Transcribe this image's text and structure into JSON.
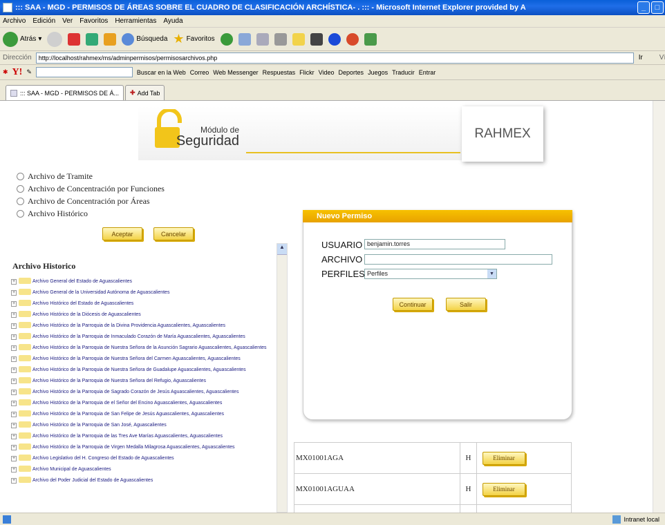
{
  "window": {
    "title": "::: SAA - MGD - PERMISOS DE ÁREAS SOBRE EL CUADRO DE CLASIFICACIÓN ARCHÍSTICA- . ::: - Microsoft Internet Explorer provided by A"
  },
  "menu": [
    "Archivo",
    "Edición",
    "Ver",
    "Favoritos",
    "Herramientas",
    "Ayuda"
  ],
  "toolbar": {
    "back": "Atrás",
    "search": "Búsqueda",
    "favorites": "Favoritos"
  },
  "address": {
    "label": "Dirección",
    "url": "http://localhost/rahmex/ms/adminpermisos/permisosarchivos.php",
    "go": "Ir",
    "links": "Vínculos"
  },
  "yahoo": {
    "search_btn": "Buscar en la Web",
    "correo": "Correo",
    "messenger": "Web Messenger",
    "respuestas": "Respuestas",
    "flickr": "Flickr",
    "video": "Video",
    "deportes": "Deportes",
    "juegos": "Juegos",
    "traducir": "Traducir",
    "entrar": "Entrar"
  },
  "tabs": {
    "active": "::: SAA - MGD - PERMISOS DE Á...",
    "add": "Add Tab"
  },
  "banner": {
    "line1": "Módulo de",
    "line2": "Seguridad",
    "brand": "RAHMEX"
  },
  "radios": [
    "Archivo de Tramite",
    "Archivo de Concentración por Funciones",
    "Archivo de Concentración por Áreas",
    "Archivo Histórico"
  ],
  "buttons": {
    "aceptar": "Aceptar",
    "cancelar": "Cancelar",
    "continuar": "Continuar",
    "salir": "Salir",
    "eliminar": "Eliminar"
  },
  "historico": {
    "title": "Archivo Historico",
    "items": [
      "Archivo General del Estado de Aguascalientes",
      "Archivo General de la Universidad Autónoma de Aguascalientes",
      "Archivo Histórico del Estado de Aguascalientes",
      "Archivo Histórico de la Diócesis de Aguascalientes",
      "Archivo Histórico de la Parroquia de la Divina Providencia Aguascalientes, Aguascalientes",
      "Archivo Histórico de la Parroquia de Inmaculado Corazón de María Aguascalientes, Aguascalientes",
      "Archivo Histórico de la Parroquia de Nuestra Señora de la Asunción Sagrario Aguascalientes, Aguascalientes",
      "Archivo Histórico de la Parroquia de Nuestra Señora del Carmen Aguascalientes, Aguascalientes",
      "Archivo Histórico de la Parroquia de Nuestra Señora de Guadalupe Aguascalientes, Aguascalientes",
      "Archivo Histórico de la Parroquia de Nuestra Señora del Refugio, Aguascalientes",
      "Archivo Histórico de la Parroquia de Sagrado Corazón de Jesús Aguascalientes, Aguascalientes",
      "Archivo Histórico de la Parroquia de el Señor del Encino Aguascalientes, Aguascalientes",
      "Archivo Histórico de la Parroquia de San Felipe de Jesús Aguascalientes, Aguascalientes",
      "Archivo Histórico de la Parroquia de San José, Aguascalientes",
      "Archivo Histórico de la Parroquia de las Tres Ave Marías Aguascalientes, Aguascalientes",
      "Archivo Histórico de la Parroquia de Virgen Medalla Milagrosa Aguascalientes, Aguascalientes",
      "Archivo Legislativo del H. Congreso del Estado de Aguascalientes",
      "Archivo Municipal de Aguascalientes",
      "Archivo del Poder Judicial del Estado de Aguascalientes"
    ]
  },
  "permiso": {
    "title": "Nuevo Permiso",
    "usuario_label": "USUARIO",
    "usuario_value": "benjamin.torres",
    "archivo_label": "ARCHIVO",
    "archivo_value": "",
    "perfiles_label": "PERFILES",
    "perfiles_value": "Perfiles"
  },
  "rows": [
    {
      "code": "MX01001AGA",
      "type": "H"
    },
    {
      "code": "MX01001AGUAA",
      "type": "H"
    }
  ],
  "status": {
    "zone": "Intranet local"
  }
}
